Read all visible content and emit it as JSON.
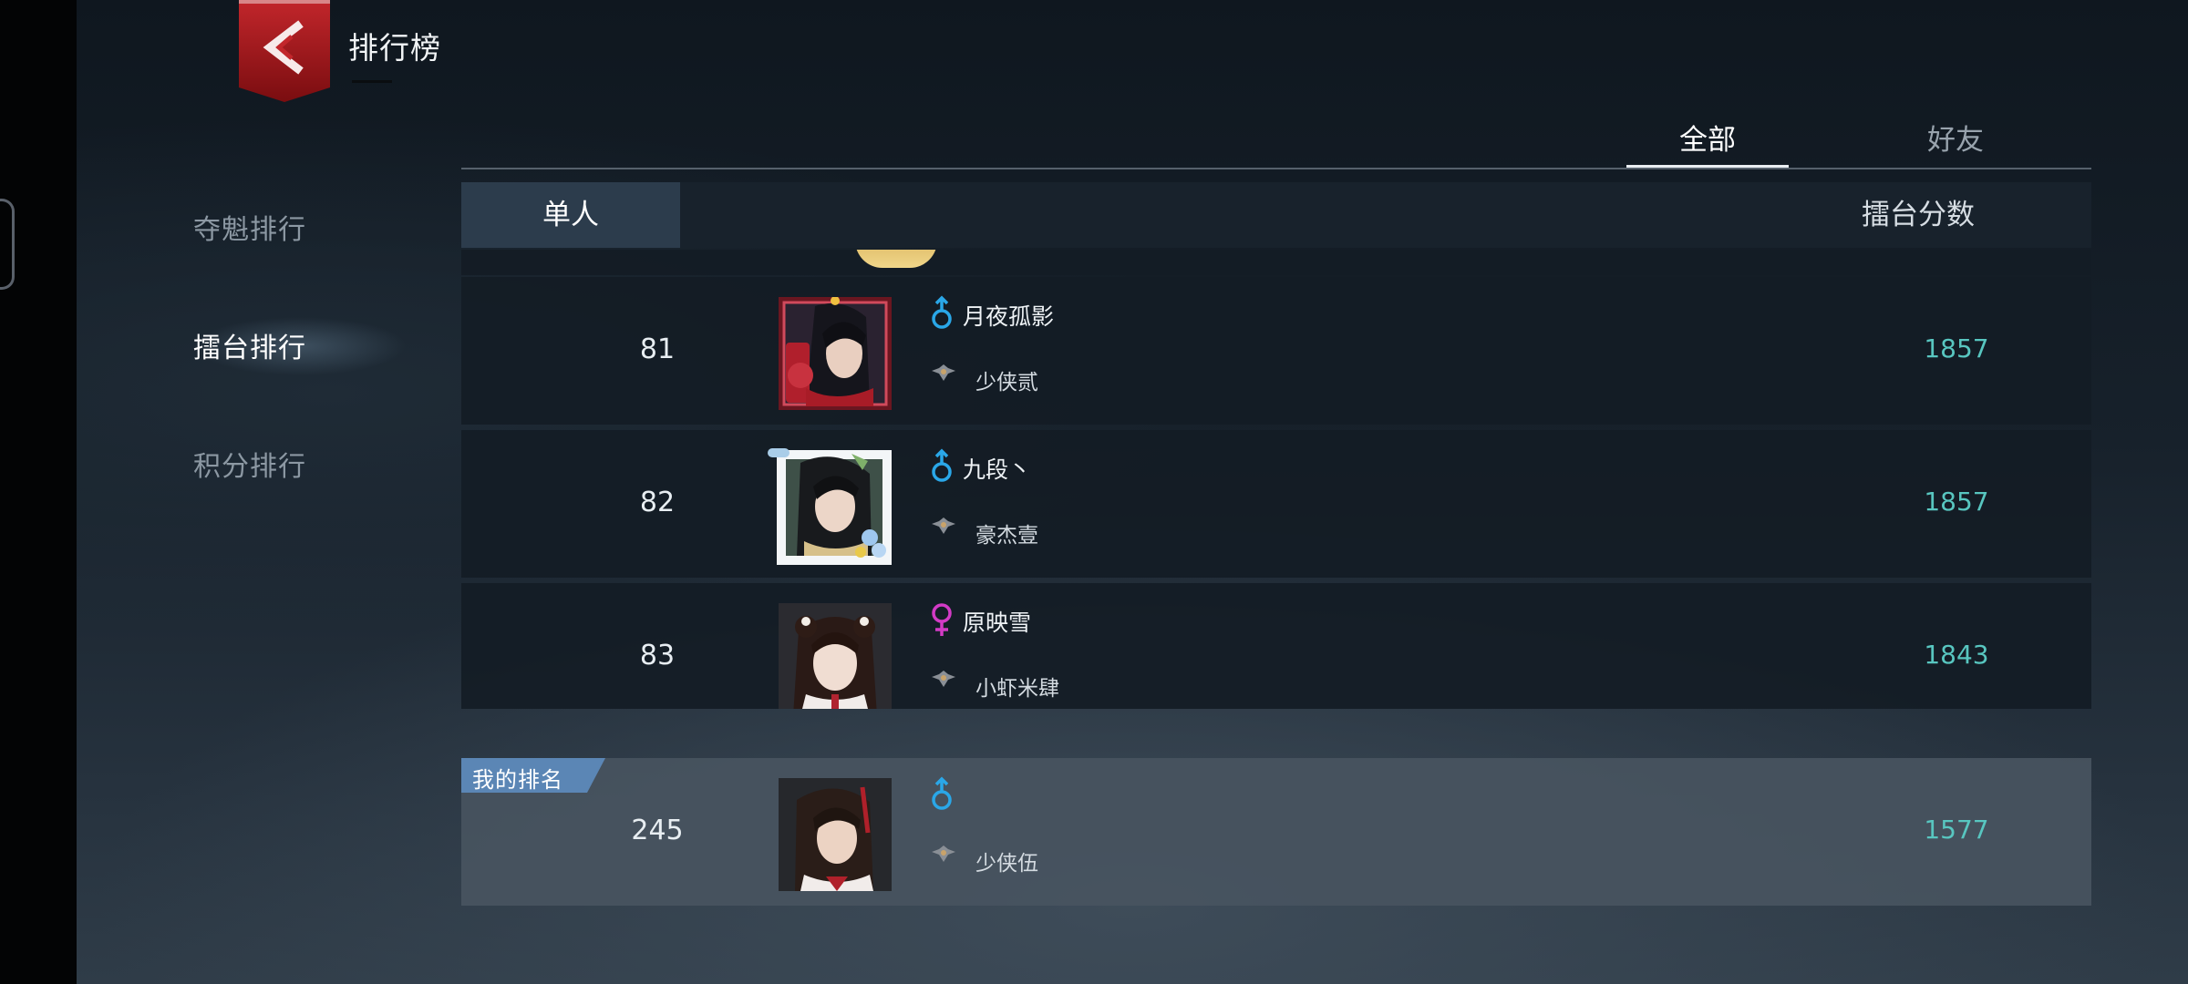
{
  "header": {
    "title": "排行榜"
  },
  "sidebar": {
    "items": [
      {
        "label": "夺魁排行"
      },
      {
        "label": "擂台排行"
      },
      {
        "label": "积分排行"
      }
    ],
    "active_index": 1
  },
  "tabs": {
    "all": "全部",
    "friends": "好友",
    "active": "全部"
  },
  "table": {
    "sub_tab": "单人",
    "score_column": "擂台分数"
  },
  "rows": [
    {
      "rank": "81",
      "name": "月夜孤影",
      "gender": "male",
      "title": "少侠贰",
      "score": "1857"
    },
    {
      "rank": "82",
      "name": "九段丶",
      "gender": "male",
      "title": "豪杰壹",
      "score": "1857"
    },
    {
      "rank": "83",
      "name": "原映雪",
      "gender": "female",
      "title": "小虾米肆",
      "score": "1843"
    }
  ],
  "my_rank": {
    "badge": "我的排名",
    "rank": "245",
    "name": "",
    "gender": "male",
    "title": "少侠伍",
    "score": "1577"
  },
  "colors": {
    "score": "#58c6c0",
    "male": "#2aa7e8",
    "female": "#d33bc6",
    "back_button": "#a3171a",
    "my_rank_badge": "#5b86b5"
  },
  "icons": {
    "back": "back-chevron-icon",
    "male": "male-symbol-icon",
    "female": "female-symbol-icon",
    "title_rank": "rank-emblem-icon"
  }
}
